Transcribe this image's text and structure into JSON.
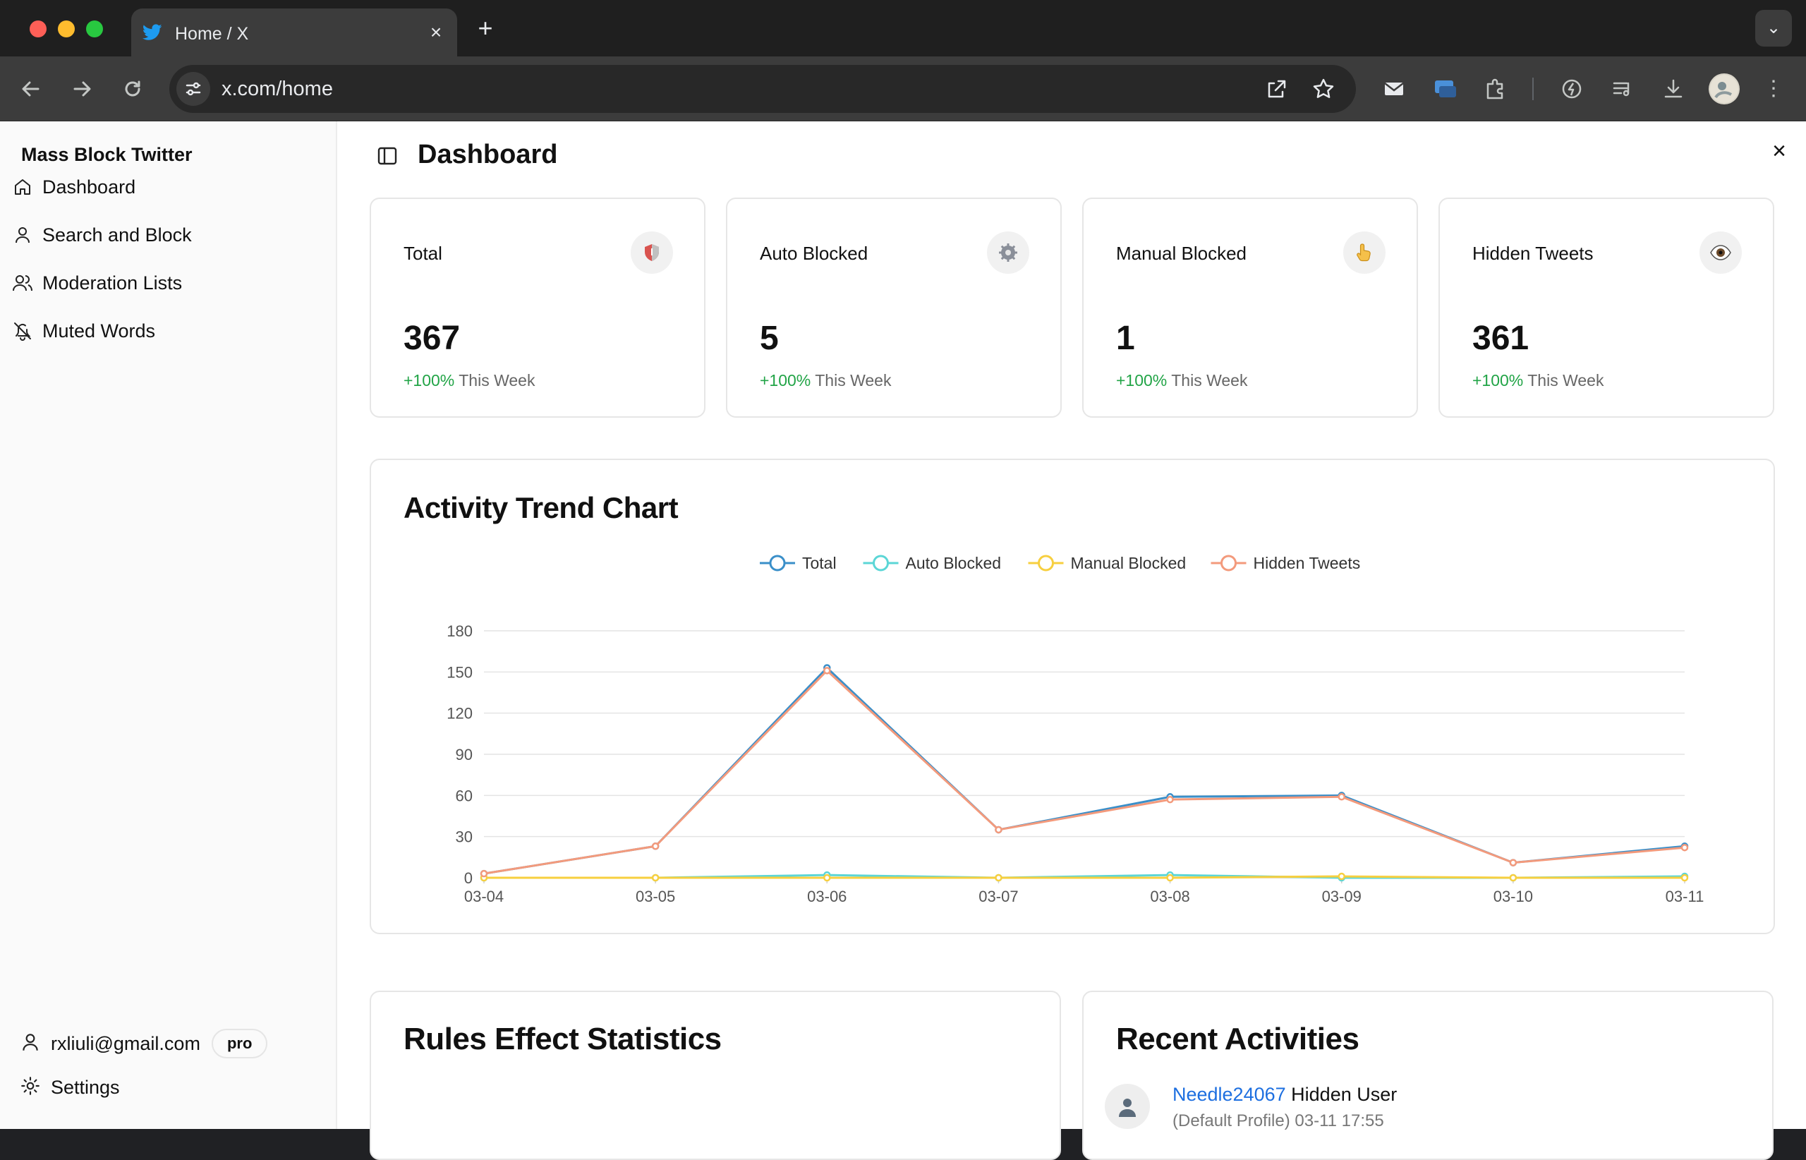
{
  "browser": {
    "tab_title": "Home / X",
    "url": "x.com/home"
  },
  "sidebar": {
    "brand": "Mass Block Twitter",
    "items": [
      {
        "label": "Dashboard",
        "icon": "home-icon"
      },
      {
        "label": "Search and Block",
        "icon": "user-icon"
      },
      {
        "label": "Moderation Lists",
        "icon": "users-icon"
      },
      {
        "label": "Muted Words",
        "icon": "bell-off-icon"
      }
    ],
    "user_email": "rxliuli@gmail.com",
    "plan_badge": "pro",
    "settings_label": "Settings"
  },
  "header": {
    "title": "Dashboard",
    "close": "×"
  },
  "stats": [
    {
      "label": "Total",
      "value": "367",
      "change_pct": "+100%",
      "change_text": "This Week",
      "icon": "shield-icon"
    },
    {
      "label": "Auto Blocked",
      "value": "5",
      "change_pct": "+100%",
      "change_text": "This Week",
      "icon": "gear-icon"
    },
    {
      "label": "Manual Blocked",
      "value": "1",
      "change_pct": "+100%",
      "change_text": "This Week",
      "icon": "pointing-hand-icon"
    },
    {
      "label": "Hidden Tweets",
      "value": "361",
      "change_pct": "+100%",
      "change_text": "This Week",
      "icon": "eye-icon"
    }
  ],
  "chart_data": {
    "type": "line",
    "title": "Activity Trend Chart",
    "categories": [
      "03-04",
      "03-05",
      "03-06",
      "03-07",
      "03-08",
      "03-09",
      "03-10",
      "03-11"
    ],
    "ylim": [
      0,
      180
    ],
    "yticks": [
      0,
      30,
      60,
      90,
      120,
      150,
      180
    ],
    "grid": true,
    "legend_position": "top-center",
    "series": [
      {
        "name": "Total",
        "color": "#3a8fc9",
        "values": [
          3,
          23,
          153,
          35,
          59,
          60,
          11,
          23
        ]
      },
      {
        "name": "Auto Blocked",
        "color": "#5bd6d6",
        "values": [
          0,
          0,
          2,
          0,
          2,
          0,
          0,
          1
        ]
      },
      {
        "name": "Manual Blocked",
        "color": "#f7cf3f",
        "values": [
          0,
          0,
          0,
          0,
          0,
          1,
          0,
          0
        ]
      },
      {
        "name": "Hidden Tweets",
        "color": "#f39a7c",
        "values": [
          3,
          23,
          151,
          35,
          57,
          59,
          11,
          22
        ]
      }
    ]
  },
  "rules_section": {
    "title": "Rules Effect Statistics"
  },
  "recent": {
    "title": "Recent Activities",
    "items": [
      {
        "user": "Needle24067",
        "action": "Hidden User",
        "detail": "(Default Profile) 03-11 17:55"
      }
    ]
  }
}
